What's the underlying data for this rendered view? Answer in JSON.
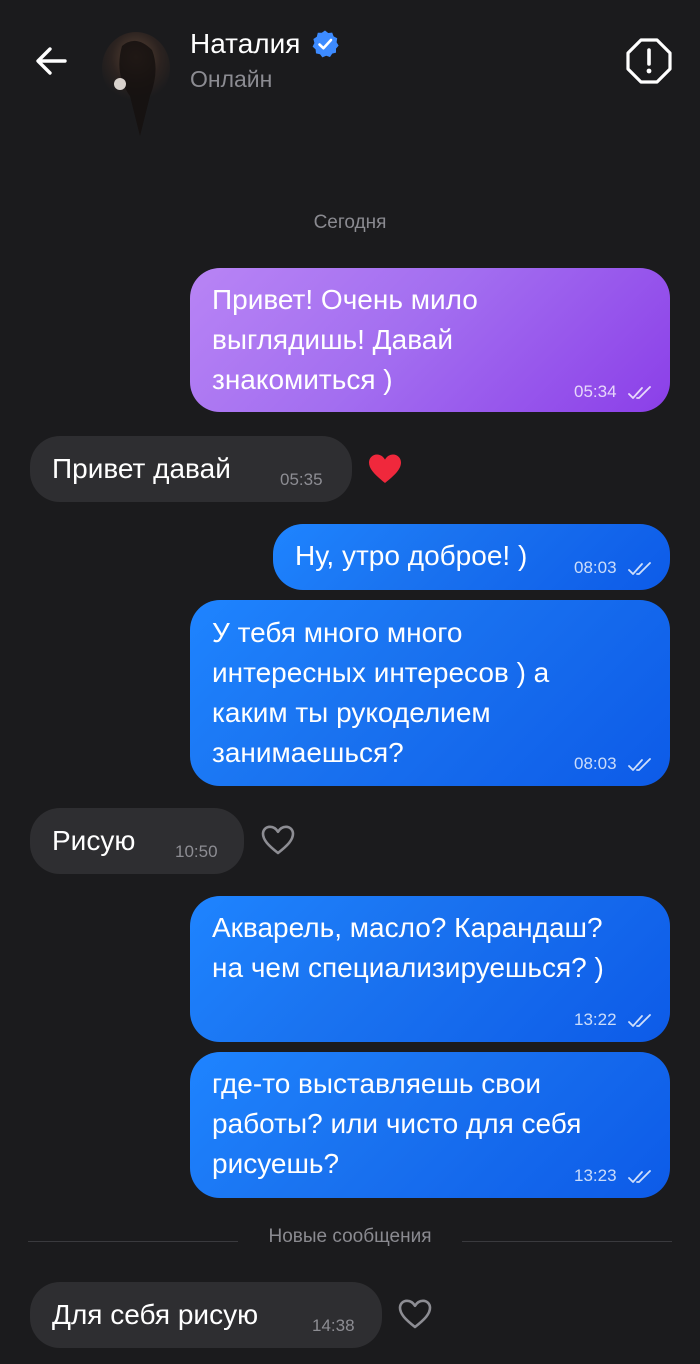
{
  "header": {
    "contact_name": "Наталия",
    "status": "Онлайн"
  },
  "date_separator": "Сегодня",
  "new_messages_label": "Новые сообщения",
  "colors": {
    "background": "#1b1b1d",
    "incoming_bubble": "#2e2e31",
    "outgoing_blue": "#1a73f0",
    "outgoing_purple": "#a36ef0",
    "verified_badge": "#3d8bff",
    "heart": "#f0283c"
  },
  "messages": [
    {
      "id": 0,
      "direction": "outgoing",
      "lines": [
        "Привет! Очень мило",
        "выглядишь! Давай",
        "знакомиться )"
      ],
      "time": "05:34",
      "read": true
    },
    {
      "id": 1,
      "direction": "incoming",
      "lines": [
        "Привет давай"
      ],
      "time": "05:35",
      "reaction": "heart-filled"
    },
    {
      "id": 2,
      "direction": "outgoing",
      "lines": [
        "Ну, утро доброе! )"
      ],
      "time": "08:03",
      "read": true
    },
    {
      "id": 3,
      "direction": "outgoing",
      "lines": [
        "У тебя много много",
        "интересных интересов ) а",
        "каким ты рукоделием",
        "занимаешься?"
      ],
      "time": "08:03",
      "read": true
    },
    {
      "id": 4,
      "direction": "incoming",
      "lines": [
        "Рисую"
      ],
      "time": "10:50",
      "reaction": "heart-outline"
    },
    {
      "id": 5,
      "direction": "outgoing",
      "lines": [
        "Акварель, масло? Карандаш?",
        "на чем специализируешься? )"
      ],
      "time": "13:22",
      "read": true
    },
    {
      "id": 6,
      "direction": "outgoing",
      "lines": [
        "где-то выставляешь свои",
        "работы? или чисто для себя",
        "рисуешь?"
      ],
      "time": "13:23",
      "read": true
    },
    {
      "id": 7,
      "direction": "incoming",
      "lines": [
        "Для себя рисую"
      ],
      "time": "14:38",
      "reaction": "heart-outline"
    }
  ]
}
